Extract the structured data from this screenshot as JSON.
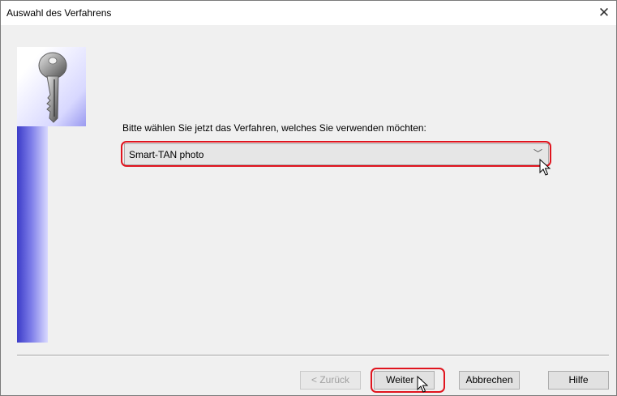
{
  "window": {
    "title": "Auswahl des Verfahrens",
    "close_glyph": "✕"
  },
  "content": {
    "prompt": "Bitte wählen Sie jetzt das Verfahren, welches Sie verwenden möchten:",
    "procedure_select": {
      "value": "Smart-TAN photo",
      "arrow_glyph": "﹀"
    }
  },
  "buttons": {
    "back": "< Zurück",
    "next": "Weiter >",
    "cancel": "Abbrechen",
    "help": "Hilfe"
  },
  "colors": {
    "highlight": "#e0141e",
    "side_panel": "#3c3cc8"
  },
  "icons": [
    "key-icon",
    "close-icon",
    "chevron-down-icon",
    "mouse-cursor-icon"
  ]
}
